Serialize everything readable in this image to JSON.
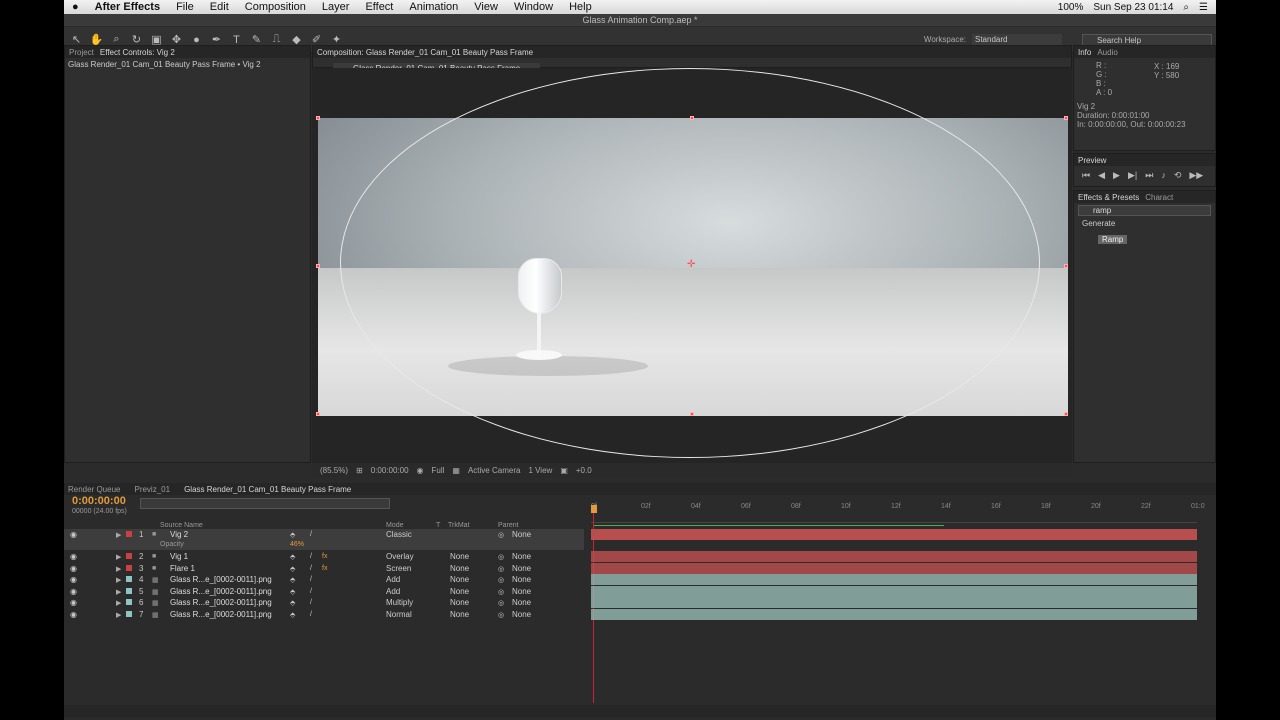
{
  "menubar": {
    "apple_icon": "apple-icon",
    "app_name": "After Effects",
    "items": [
      "File",
      "Edit",
      "Composition",
      "Layer",
      "Effect",
      "Animation",
      "View",
      "Window",
      "Help"
    ],
    "battery": "100%",
    "datetime": "Sun Sep 23  01:14"
  },
  "window": {
    "title": "Glass Animation Comp.aep *"
  },
  "toolbar": {
    "workspace_label": "Workspace:",
    "workspace_value": "Standard",
    "search_placeholder": "Search Help"
  },
  "left_panel": {
    "tab_project": "Project",
    "tab_effect_controls": "Effect Controls: Vig 2",
    "header": "Glass Render_01 Cam_01 Beauty Pass Frame • Vig 2"
  },
  "composition": {
    "tab": "Composition: Glass Render_01 Cam_01 Beauty Pass Frame",
    "breadcrumb": "Glass Render_01 Cam_01 Beauty Pass Frame"
  },
  "viewer_bar": {
    "zoom": "(85.5%)",
    "timecode": "0:00:00:00",
    "resolution": "Full",
    "camera": "Active Camera",
    "views": "1 View",
    "exposure": "+0.0"
  },
  "info": {
    "tab_info": "Info",
    "tab_audio": "Audio",
    "r": "R :",
    "g": "G :",
    "b": "B :",
    "a": "A : 0",
    "x": "X : 169",
    "y": "Y : 580",
    "layer": "Vig 2",
    "duration": "Duration: 0:00:01:00",
    "inout": "In: 0:00:00:00, Out: 0:00:00:23"
  },
  "preview": {
    "tab": "Preview"
  },
  "effects": {
    "tab": "Effects & Presets",
    "tab2": "Charact",
    "search": "ramp",
    "category": "Generate",
    "item": "Ramp"
  },
  "timeline": {
    "tab_render": "Render Queue",
    "tab_previz": "Previz_01",
    "tab_comp": "Glass Render_01 Cam_01 Beauty Pass Frame",
    "timecode": "0:00:00:00",
    "fps": "00000 (24.00 fps)",
    "col_source": "Source Name",
    "col_mode": "Mode",
    "col_trkmat": "TrkMat",
    "col_t": "T",
    "col_parent": "Parent",
    "ruler": [
      "0f",
      "02f",
      "04f",
      "06f",
      "08f",
      "10f",
      "12f",
      "14f",
      "16f",
      "18f",
      "20f",
      "22f",
      "01:0"
    ],
    "opacity_label": "Opacity",
    "opacity_value": "46%",
    "layers": [
      {
        "num": "1",
        "name": "Vig 2",
        "mode": "Classic",
        "trkmat": "",
        "parent": "None",
        "label": "#c94141",
        "type": "solid",
        "fx": false
      },
      {
        "num": "2",
        "name": "Vig 1",
        "mode": "Overlay",
        "trkmat": "None",
        "parent": "None",
        "label": "#c94141",
        "type": "solid",
        "fx": true
      },
      {
        "num": "3",
        "name": "Flare 1",
        "mode": "Screen",
        "trkmat": "None",
        "parent": "None",
        "label": "#c94141",
        "type": "solid",
        "fx": true
      },
      {
        "num": "4",
        "name": "Glass R...e_[0002-0011].png",
        "mode": "Add",
        "trkmat": "None",
        "parent": "None",
        "label": "#8fc4c4",
        "type": "footage",
        "fx": false
      },
      {
        "num": "5",
        "name": "Glass R...e_[0002-0011].png",
        "mode": "Add",
        "trkmat": "None",
        "parent": "None",
        "label": "#8fc4c4",
        "type": "footage",
        "fx": false
      },
      {
        "num": "6",
        "name": "Glass R...e_[0002-0011].png",
        "mode": "Multiply",
        "trkmat": "None",
        "parent": "None",
        "label": "#8fc4c4",
        "type": "footage",
        "fx": false
      },
      {
        "num": "7",
        "name": "Glass R...e_[0002-0011].png",
        "mode": "Normal",
        "trkmat": "None",
        "parent": "None",
        "label": "#8fc4c4",
        "type": "footage",
        "fx": false
      }
    ]
  },
  "colors": {
    "bar_red": "#b94e4e",
    "bar_teal": "#8fb1ac",
    "accent": "#e39a3b"
  }
}
